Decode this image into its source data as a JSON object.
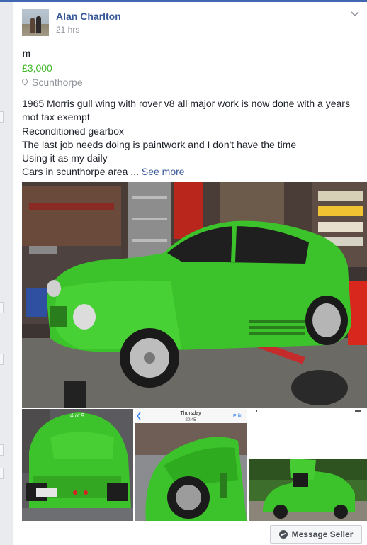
{
  "post": {
    "author": "Alan Charlton",
    "time": "21 hrs",
    "title": "m",
    "price": "£3,000",
    "location": "Scunthorpe",
    "description_lines": [
      "1965 Morris gull wing with rover v8 all major work is now done with a years",
      "mot tax exempt",
      "Reconditioned gearbox",
      "The last job needs doing is paintwork and I don't have the time",
      "Using it as my daily",
      "Cars in scunthorpe area ..."
    ],
    "see_more": "See more"
  },
  "thumbs": {
    "t1_counter": "4 of 9",
    "phone_day": "Thursday",
    "phone_time": "20:45",
    "phone_edit": "Edit"
  },
  "actions": {
    "message_seller": "Message Seller"
  },
  "colors": {
    "link": "#385898",
    "price": "#42b72a",
    "car_green": "#3cc22a",
    "accent": "#4267b2"
  },
  "icons": [
    "chevron-down-icon",
    "location-pin-icon",
    "messenger-icon",
    "back-chevron-icon"
  ]
}
